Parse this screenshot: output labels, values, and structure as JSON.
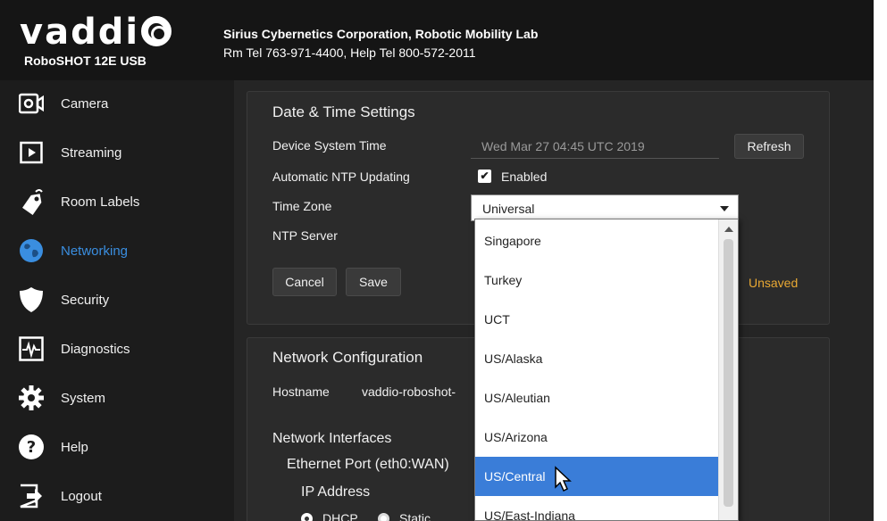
{
  "header": {
    "brand": "vadd",
    "model": "RoboSHOT 12E USB",
    "company": "Sirius Cybernetics Corporation, Robotic Mobility Lab",
    "phones": "Rm Tel 763-971-4400, Help Tel 800-572-2011"
  },
  "sidebar": {
    "items": [
      {
        "label": "Camera",
        "icon": "camera-icon",
        "active": false
      },
      {
        "label": "Streaming",
        "icon": "play-icon",
        "active": false
      },
      {
        "label": "Room Labels",
        "icon": "tag-icon",
        "active": false
      },
      {
        "label": "Networking",
        "icon": "globe-icon",
        "active": true
      },
      {
        "label": "Security",
        "icon": "shield-icon",
        "active": false
      },
      {
        "label": "Diagnostics",
        "icon": "pulse-icon",
        "active": false
      },
      {
        "label": "System",
        "icon": "gear-icon",
        "active": false
      },
      {
        "label": "Help",
        "icon": "help-icon",
        "active": false
      },
      {
        "label": "Logout",
        "icon": "logout-icon",
        "active": false
      }
    ],
    "active_color": "#3a8ee0"
  },
  "datetime": {
    "title": "Date & Time Settings",
    "system_time_label": "Device System Time",
    "system_time_value": "Wed Mar 27 04:45 UTC 2019",
    "refresh_label": "Refresh",
    "ntp_label": "Automatic NTP Updating",
    "ntp_enabled_label": "Enabled",
    "ntp_checked": true,
    "timezone_label": "Time Zone",
    "timezone_value": "Universal",
    "ntp_server_label": "NTP Server",
    "cancel_label": "Cancel",
    "save_label": "Save",
    "status": "Unsaved",
    "status_color": "#e8a833"
  },
  "network": {
    "title": "Network Configuration",
    "hostname_label": "Hostname",
    "hostname_value": "vaddio-roboshot-",
    "interfaces_label": "Network Interfaces",
    "port_label": "Ethernet Port (eth0:WAN)",
    "ip_label": "IP Address",
    "dhcp_label": "DHCP",
    "static_label": "Static",
    "dhcp_selected": true
  },
  "timezone_dropdown": {
    "options": [
      "Singapore",
      "Turkey",
      "UCT",
      "US/Alaska",
      "US/Aleutian",
      "US/Arizona",
      "US/Central",
      "US/East-Indiana"
    ],
    "highlighted": "US/Central",
    "highlight_color": "#3a7dd8"
  }
}
